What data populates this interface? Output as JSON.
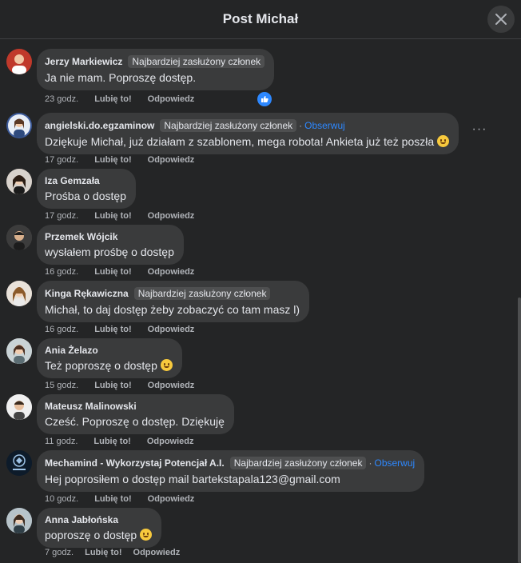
{
  "header": {
    "title": "Post Michał"
  },
  "comments": [
    {
      "author": "Jerzy Markiewicz",
      "badge": "Najbardziej zasłużony członek",
      "follow": "",
      "text": "Ja nie mam. Poproszę dostęp.",
      "emoji": false,
      "time": "23 godz.",
      "like": "Lubię to!",
      "reply": "Odpowiedz",
      "reaction": "like-icon",
      "avatar_color": "#c0392b"
    },
    {
      "author": "angielski.do.egzaminow",
      "badge": "Najbardziej zasłużony członek",
      "follow": "Obserwuj",
      "text": "Dziękuje Michał, już działam z szablonem, mega robota! Ankieta już też poszła",
      "emoji": true,
      "time": "17 godz.",
      "like": "Lubię to!",
      "reply": "Odpowiedz",
      "avatar_color": "#3b5998"
    },
    {
      "author": "Iza Gemzała",
      "badge": "",
      "follow": "",
      "text": "Prośba o dostęp",
      "emoji": false,
      "time": "17 godz.",
      "like": "Lubię to!",
      "reply": "Odpowiedz",
      "avatar_color": "#6b5b4f"
    },
    {
      "author": "Przemek Wójcik",
      "badge": "",
      "follow": "",
      "text": "wysłałem prośbę o dostęp",
      "emoji": false,
      "time": "16 godz.",
      "like": "Lubię to!",
      "reply": "Odpowiedz",
      "avatar_color": "#4a4a4a"
    },
    {
      "author": "Kinga Rękawiczna",
      "badge": "Najbardziej zasłużony członek",
      "follow": "",
      "text": "Michał, to daj dostęp żeby zobaczyć co tam masz l)",
      "emoji": false,
      "time": "16 godz.",
      "like": "Lubię to!",
      "reply": "Odpowiedz",
      "avatar_color": "#8d6e63"
    },
    {
      "author": "Ania Żelazo",
      "badge": "",
      "follow": "",
      "text": "Też poproszę o dostęp",
      "emoji": true,
      "time": "15 godz.",
      "like": "Lubię to!",
      "reply": "Odpowiedz",
      "avatar_color": "#a1887f"
    },
    {
      "author": "Mateusz Malinowski",
      "badge": "",
      "follow": "",
      "text": "Cześć. Poproszę o dostęp. Dziękuję",
      "emoji": false,
      "time": "11 godz.",
      "like": "Lubię to!",
      "reply": "Odpowiedz",
      "avatar_color": "#9e9e9e"
    },
    {
      "author": "Mechamind - Wykorzystaj Potencjał A.I.",
      "badge": "Najbardziej zasłużony członek",
      "follow": "Obserwuj",
      "text": "Hej poprosiłem o dostęp mail bartekstapala123@gmail.com",
      "emoji": false,
      "time": "10 godz.",
      "like": "Lubię to!",
      "reply": "Odpowiedz",
      "avatar_color": "#0d1b2a"
    },
    {
      "author": "Anna Jabłońska",
      "badge": "",
      "follow": "",
      "text": "poproszę o dostęp",
      "emoji": true,
      "time": "7 godz.",
      "like": "Lubię to!",
      "reply": "Odpowiedz",
      "avatar_color": "#78909c"
    }
  ]
}
